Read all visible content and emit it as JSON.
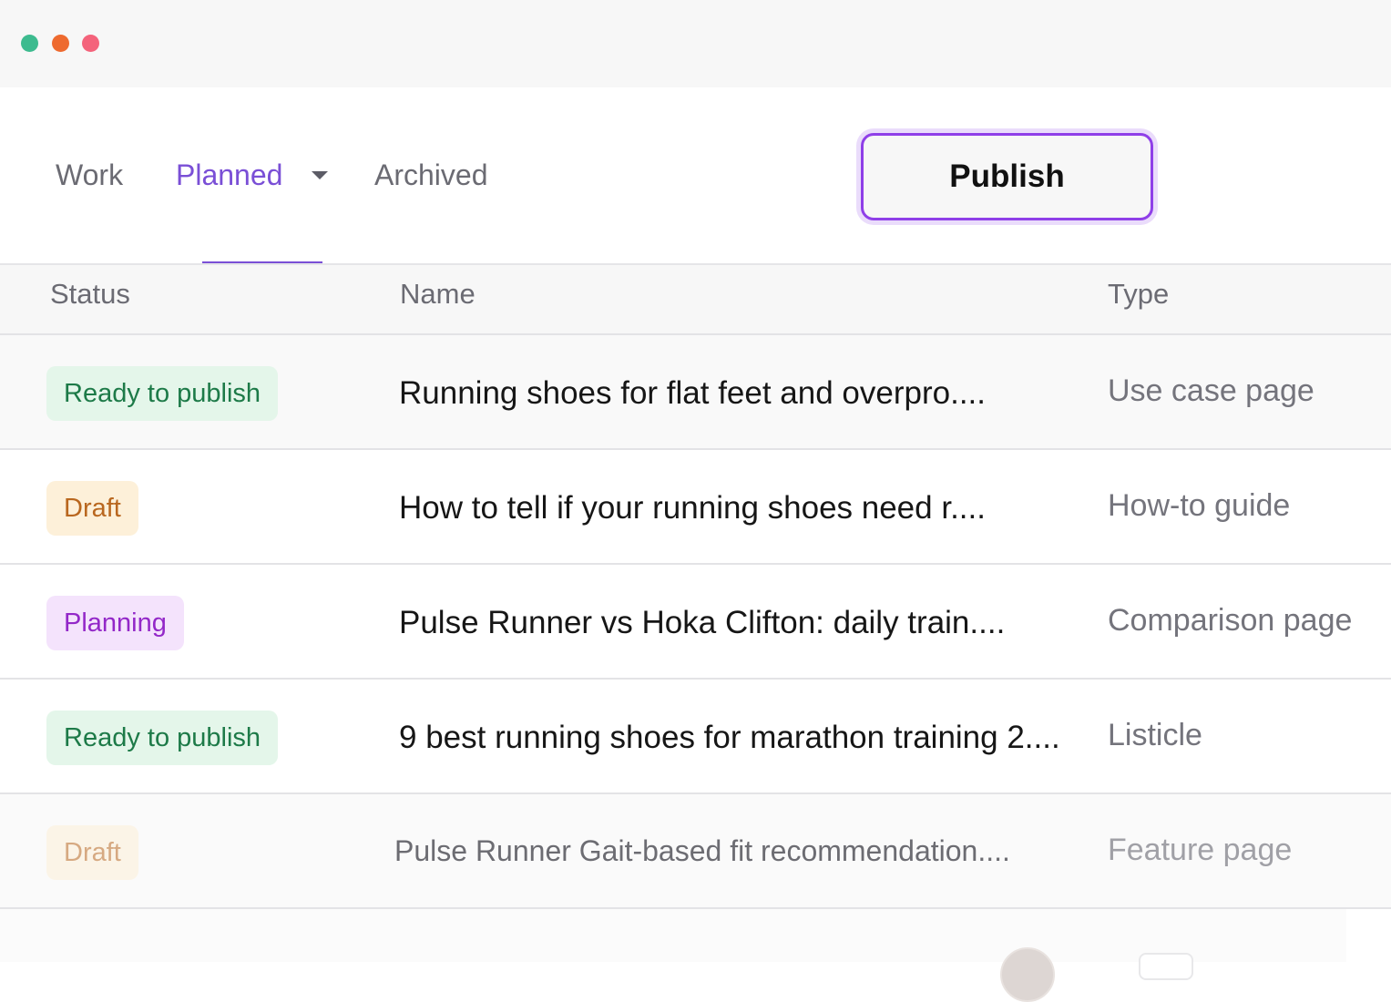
{
  "window": {
    "controls": [
      "green-dot",
      "orange-dot",
      "pink-dot"
    ]
  },
  "tabs": [
    {
      "label": "Work",
      "active": false
    },
    {
      "label": "Planned",
      "active": true,
      "dropdown": true
    },
    {
      "label": "Archived",
      "active": false
    }
  ],
  "toolbar": {
    "publish_label": "Publish"
  },
  "table": {
    "columns": [
      "Status",
      "Name",
      "Type"
    ],
    "rows": [
      {
        "status": "Ready to publish",
        "name": "Running shoes for flat feet and overpro....",
        "type": "Use case page"
      },
      {
        "status": "Draft",
        "name": "How to tell if your running shoes need r....",
        "type": "How-to guide"
      },
      {
        "status": "Planning",
        "name": "Pulse Runner vs Hoka Clifton: daily train....",
        "type": "Comparison page"
      },
      {
        "status": "Ready to publish",
        "name": "9 best running shoes for marathon training 2....",
        "type": "Listicle"
      },
      {
        "status": "Draft",
        "name": "Pulse Runner Gait-based fit recommendation....",
        "type": "Feature page"
      }
    ]
  },
  "colors": {
    "accent": "#7a4fd6",
    "publish_border": "#8f3fe8",
    "ready_bg": "#e4f6ea",
    "ready_text": "#1d7a48",
    "draft_bg": "#fdf0d9",
    "draft_text": "#b9671f",
    "planning_bg": "#f4e3fc",
    "planning_text": "#9328c8"
  }
}
